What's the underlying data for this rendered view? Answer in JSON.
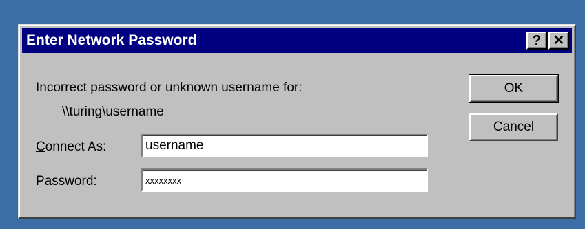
{
  "window": {
    "title": "Enter Network Password",
    "help_label": "?",
    "close_label": "✕"
  },
  "message": {
    "text": "Incorrect password or unknown username for:",
    "path": "\\\\turing\\username"
  },
  "form": {
    "connect_as": {
      "accel": "C",
      "label_rest": "onnect As:",
      "value": "username"
    },
    "password": {
      "accel": "P",
      "label_rest": "assword:",
      "value": "xxxxxxxx"
    }
  },
  "buttons": {
    "ok": "OK",
    "cancel": "Cancel"
  }
}
